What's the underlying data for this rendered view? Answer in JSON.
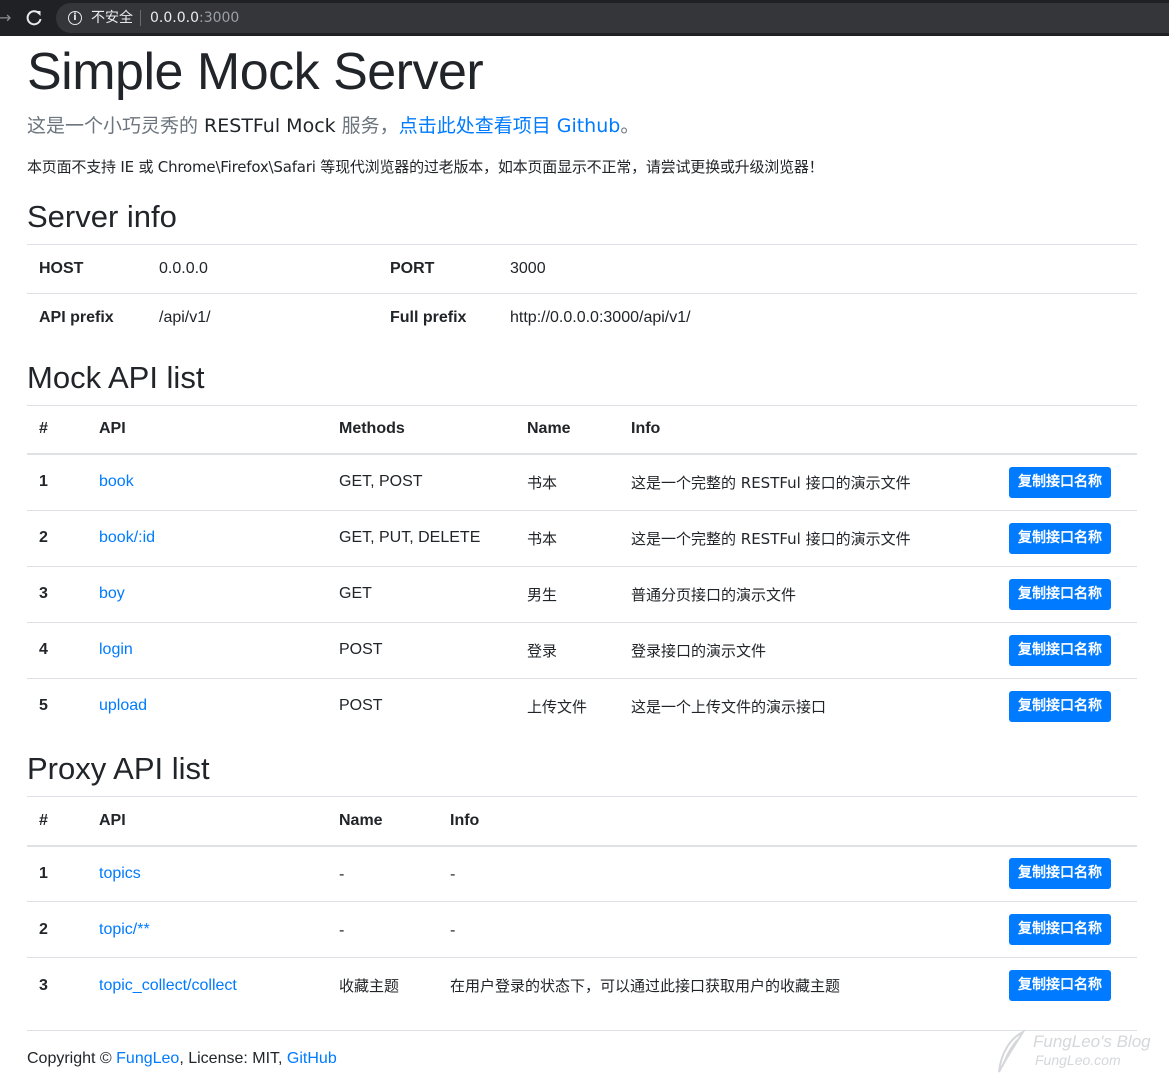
{
  "browser": {
    "security_label": "不安全",
    "url_host": "0.0.0.0",
    "url_port": ":3000"
  },
  "header": {
    "title": "Simple Mock Server",
    "lead_prefix": "这是一个小巧灵秀的 ",
    "lead_tech": "RESTFul Mock",
    "lead_suffix": " 服务，",
    "lead_link": "点击此处查看项目 Github",
    "lead_end": "。",
    "notice": "本页面不支持 IE 或 Chrome\\Firefox\\Safari 等现代浏览器的过老版本，如本页面显示不正常，请尝试更换或升级浏览器！"
  },
  "server_info": {
    "heading": "Server info",
    "host_label": "HOST",
    "host_value": "0.0.0.0",
    "port_label": "PORT",
    "port_value": "3000",
    "api_prefix_label": "API prefix",
    "api_prefix_value": "/api/v1/",
    "full_prefix_label": "Full prefix",
    "full_prefix_value": "http://0.0.0.0:3000/api/v1/"
  },
  "mock_api": {
    "heading": "Mock API list",
    "columns": [
      "#",
      "API",
      "Methods",
      "Name",
      "Info"
    ],
    "rows": [
      {
        "num": "1",
        "api": "book",
        "methods": "GET, POST",
        "name": "书本",
        "info": "这是一个完整的 RESTFul 接口的演示文件",
        "button": "复制接口名称"
      },
      {
        "num": "2",
        "api": "book/:id",
        "methods": "GET, PUT, DELETE",
        "name": "书本",
        "info": "这是一个完整的 RESTFul 接口的演示文件",
        "button": "复制接口名称"
      },
      {
        "num": "3",
        "api": "boy",
        "methods": "GET",
        "name": "男生",
        "info": "普通分页接口的演示文件",
        "button": "复制接口名称"
      },
      {
        "num": "4",
        "api": "login",
        "methods": "POST",
        "name": "登录",
        "info": "登录接口的演示文件",
        "button": "复制接口名称"
      },
      {
        "num": "5",
        "api": "upload",
        "methods": "POST",
        "name": "上传文件",
        "info": "这是一个上传文件的演示接口",
        "button": "复制接口名称"
      }
    ]
  },
  "proxy_api": {
    "heading": "Proxy API list",
    "columns": [
      "#",
      "API",
      "Name",
      "Info"
    ],
    "rows": [
      {
        "num": "1",
        "api": "topics",
        "name": "-",
        "info": "-",
        "button": "复制接口名称"
      },
      {
        "num": "2",
        "api": "topic/**",
        "name": "-",
        "info": "-",
        "button": "复制接口名称"
      },
      {
        "num": "3",
        "api": "topic_collect/collect",
        "name": "收藏主题",
        "info": "在用户登录的状态下，可以通过此接口获取用户的收藏主题",
        "button": "复制接口名称"
      }
    ]
  },
  "footer": {
    "copyright": "Copyright © ",
    "author_link": "FungLeo",
    "license": ", License: MIT, ",
    "github_link": "GitHub"
  },
  "watermark": {
    "line1": "FungLeo's Blog",
    "line2": "FungLeo.com"
  },
  "colors": {
    "link": "#007bff",
    "button": "#007bff",
    "text": "#212529",
    "muted": "#6c757d",
    "border": "#dee2e6"
  }
}
